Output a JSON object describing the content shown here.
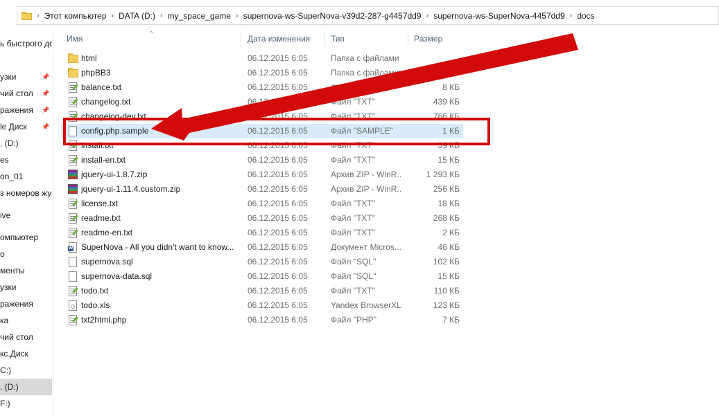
{
  "address": {
    "crumbs": [
      "Этот компьютер",
      "DATA (D:)",
      "my_space_game",
      "supernova-ws-SuperNova-v39d2-287-g4457dd9",
      "supernova-ws-SuperNova-4457dd9",
      "docs"
    ]
  },
  "nav": {
    "items": [
      {
        "label": "ь быстрого дос",
        "pinned": false
      },
      {
        "label": "узки",
        "pinned": true
      },
      {
        "label": "чий стол",
        "pinned": true
      },
      {
        "label": "ражения",
        "pinned": true
      },
      {
        "label": "le Диск",
        "pinned": true
      },
      {
        "label": ". (D:)",
        "pinned": false
      },
      {
        "label": "es",
        "pinned": false
      },
      {
        "label": "on_01",
        "pinned": false
      },
      {
        "label": "з номеров жур",
        "pinned": false
      },
      {
        "label": "ive",
        "pinned": false
      },
      {
        "label": "омпьютер",
        "pinned": false
      },
      {
        "label": "о",
        "pinned": false
      },
      {
        "label": "менты",
        "pinned": false
      },
      {
        "label": "узки",
        "pinned": false
      },
      {
        "label": "ражения",
        "pinned": false
      },
      {
        "label": "ка",
        "pinned": false
      },
      {
        "label": "чий стол",
        "pinned": false
      },
      {
        "label": "кс.Диск",
        "pinned": false
      },
      {
        "label": "C:)",
        "pinned": false
      },
      {
        "label": ". (D:)",
        "pinned": false,
        "selected": true
      },
      {
        "label": "F:)",
        "pinned": false
      }
    ]
  },
  "columns": {
    "name": "Имя",
    "date": "Дата изменения",
    "type": "Тип",
    "size": "Размер"
  },
  "files": [
    {
      "name": "html",
      "date": "06.12.2015 6:05",
      "type": "Папка с файлами",
      "size": "",
      "icon": "folder-icon"
    },
    {
      "name": "phpBB3",
      "date": "06.12.2015 6:05",
      "type": "Папка с файлами",
      "size": "",
      "icon": "folder-icon"
    },
    {
      "name": "balance.txt",
      "date": "06.12.2015 6:05",
      "type": "Файл \"TXT\"",
      "size": "8 КБ",
      "icon": "text-file-icon"
    },
    {
      "name": "changelog.txt",
      "date": "06.12.2015 6:05",
      "type": "Файл \"TXT\"",
      "size": "439 КБ",
      "icon": "text-file-icon"
    },
    {
      "name": "changelog-dev.txt",
      "date": "06.12.2015 6:05",
      "type": "Файл \"TXT\"",
      "size": "766 КБ",
      "icon": "text-file-icon"
    },
    {
      "name": "config.php.sample",
      "date": "06.12.2015 6:05",
      "type": "Файл \"SAMPLE\"",
      "size": "1 КБ",
      "icon": "blank-file-icon",
      "highlighted": true
    },
    {
      "name": "install.txt",
      "date": "06.12.2015 6:05",
      "type": "Файл \"TXT\"",
      "size": "39 КБ",
      "icon": "text-file-icon"
    },
    {
      "name": "install-en.txt",
      "date": "06.12.2015 6:05",
      "type": "Файл \"TXT\"",
      "size": "15 КБ",
      "icon": "text-file-icon"
    },
    {
      "name": "jquery-ui-1.8.7.zip",
      "date": "06.12.2015 6:05",
      "type": "Архив ZIP - WinR...",
      "size": "1 293 КБ",
      "icon": "zip-archive-icon"
    },
    {
      "name": "jquery-ui-1.11.4.custom.zip",
      "date": "06.12.2015 6:05",
      "type": "Архив ZIP - WinR...",
      "size": "256 КБ",
      "icon": "zip-archive-icon"
    },
    {
      "name": "license.txt",
      "date": "06.12.2015 6:05",
      "type": "Файл \"TXT\"",
      "size": "18 КБ",
      "icon": "text-file-icon"
    },
    {
      "name": "readme.txt",
      "date": "06.12.2015 6:05",
      "type": "Файл \"TXT\"",
      "size": "268 КБ",
      "icon": "text-file-icon"
    },
    {
      "name": "readme-en.txt",
      "date": "06.12.2015 6:05",
      "type": "Файл \"TXT\"",
      "size": "2 КБ",
      "icon": "text-file-icon"
    },
    {
      "name": "SuperNova - All you didn't want to know...",
      "date": "06.12.2015 6:05",
      "type": "Документ Micros...",
      "size": "46 КБ",
      "icon": "word-document-icon"
    },
    {
      "name": "supernova.sql",
      "date": "06.12.2015 6:05",
      "type": "Файл \"SQL\"",
      "size": "102 КБ",
      "icon": "blank-file-icon"
    },
    {
      "name": "supernova-data.sql",
      "date": "06.12.2015 6:05",
      "type": "Файл \"SQL\"",
      "size": "15 КБ",
      "icon": "blank-file-icon"
    },
    {
      "name": "todo.txt",
      "date": "06.12.2015 6:05",
      "type": "Файл \"TXT\"",
      "size": "110 КБ",
      "icon": "text-file-icon"
    },
    {
      "name": "todo.xls",
      "date": "06.12.2015 6:05",
      "type": "Yandex BrowserXL...",
      "size": "123 КБ",
      "icon": "spreadsheet-file-icon"
    },
    {
      "name": "txt2html.php",
      "date": "06.12.2015 6:05",
      "type": "Файл \"PHP\"",
      "size": "7 КБ",
      "icon": "text-file-icon"
    }
  ],
  "colors": {
    "annotation": "#d20a0a",
    "row_highlight": "#d9ebfa",
    "header_text": "#4c607a"
  }
}
